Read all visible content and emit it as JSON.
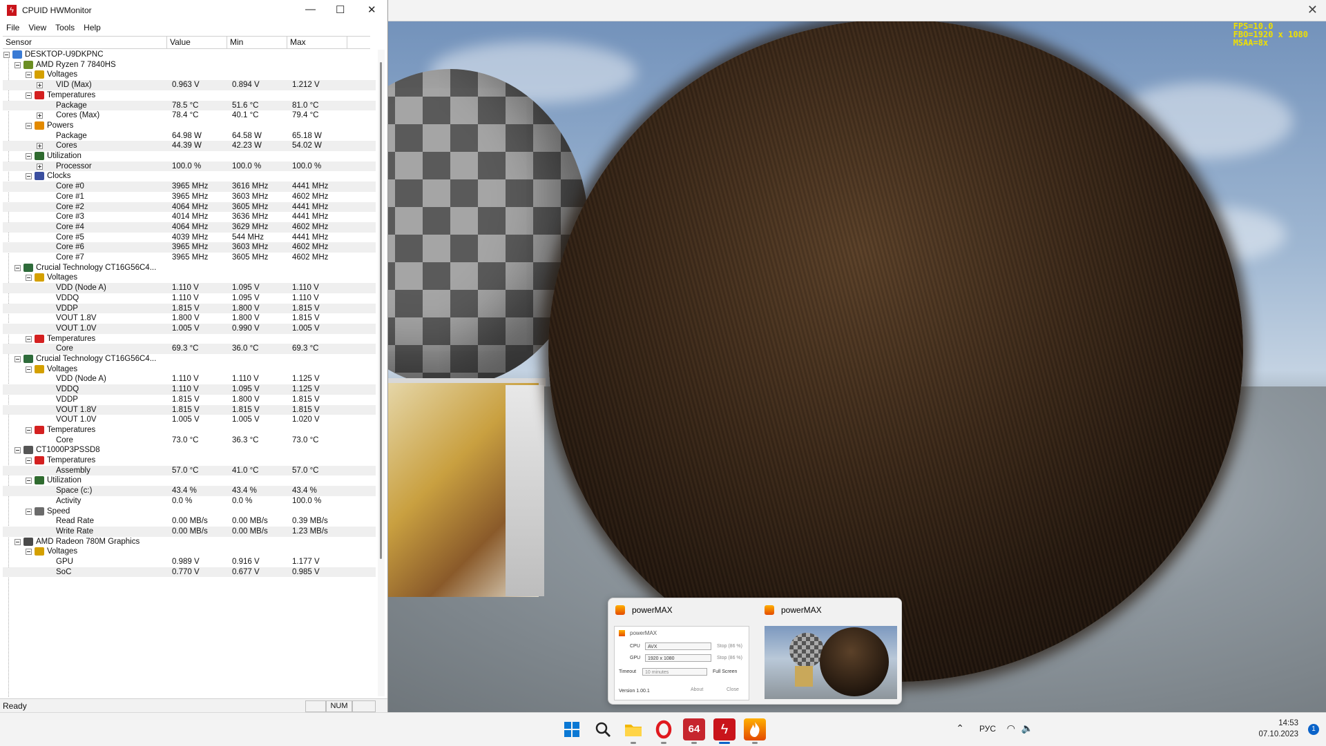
{
  "hwmonitor": {
    "title": "CPUID HWMonitor",
    "menu": [
      "File",
      "View",
      "Tools",
      "Help"
    ],
    "columns": [
      "Sensor",
      "Value",
      "Min",
      "Max"
    ],
    "status": "Ready",
    "num_indicator": "NUM",
    "rows": [
      {
        "depth": 0,
        "label": "DESKTOP-U9DKPNC",
        "icon": "computer-icon",
        "expander": "minus"
      },
      {
        "depth": 1,
        "label": "AMD Ryzen 7 7840HS",
        "icon": "cpu-icon",
        "expander": "minus"
      },
      {
        "depth": 2,
        "label": "Voltages",
        "icon": "voltage-icon",
        "expander": "minus"
      },
      {
        "depth": 3,
        "label": "VID (Max)",
        "expander": "plus",
        "value": "0.963 V",
        "min": "0.894 V",
        "max": "1.212 V"
      },
      {
        "depth": 2,
        "label": "Temperatures",
        "icon": "thermometer-icon",
        "expander": "minus"
      },
      {
        "depth": 3,
        "label": "Package",
        "value": "78.5 °C",
        "min": "51.6 °C",
        "max": "81.0 °C"
      },
      {
        "depth": 3,
        "label": "Cores (Max)",
        "expander": "plus",
        "value": "78.4 °C",
        "min": "40.1 °C",
        "max": "79.4 °C"
      },
      {
        "depth": 2,
        "label": "Powers",
        "icon": "power-icon",
        "expander": "minus"
      },
      {
        "depth": 3,
        "label": "Package",
        "value": "64.98 W",
        "min": "64.58 W",
        "max": "65.18 W"
      },
      {
        "depth": 3,
        "label": "Cores",
        "expander": "plus",
        "value": "44.39 W",
        "min": "42.23 W",
        "max": "54.02 W"
      },
      {
        "depth": 2,
        "label": "Utilization",
        "icon": "utilization-icon",
        "expander": "minus"
      },
      {
        "depth": 3,
        "label": "Processor",
        "expander": "plus",
        "value": "100.0 %",
        "min": "100.0 %",
        "max": "100.0 %"
      },
      {
        "depth": 2,
        "label": "Clocks",
        "icon": "clock-bars-icon",
        "expander": "minus"
      },
      {
        "depth": 3,
        "label": "Core #0",
        "value": "3965 MHz",
        "min": "3616 MHz",
        "max": "4441 MHz"
      },
      {
        "depth": 3,
        "label": "Core #1",
        "value": "3965 MHz",
        "min": "3603 MHz",
        "max": "4602 MHz"
      },
      {
        "depth": 3,
        "label": "Core #2",
        "value": "4064 MHz",
        "min": "3605 MHz",
        "max": "4441 MHz"
      },
      {
        "depth": 3,
        "label": "Core #3",
        "value": "4014 MHz",
        "min": "3636 MHz",
        "max": "4441 MHz"
      },
      {
        "depth": 3,
        "label": "Core #4",
        "value": "4064 MHz",
        "min": "3629 MHz",
        "max": "4602 MHz"
      },
      {
        "depth": 3,
        "label": "Core #5",
        "value": "4039 MHz",
        "min": "544 MHz",
        "max": "4441 MHz"
      },
      {
        "depth": 3,
        "label": "Core #6",
        "value": "3965 MHz",
        "min": "3603 MHz",
        "max": "4602 MHz"
      },
      {
        "depth": 3,
        "label": "Core #7",
        "value": "3965 MHz",
        "min": "3605 MHz",
        "max": "4602 MHz"
      },
      {
        "depth": 1,
        "label": "Crucial Technology CT16G56C4...",
        "icon": "ram-icon",
        "expander": "minus"
      },
      {
        "depth": 2,
        "label": "Voltages",
        "icon": "voltage-icon",
        "expander": "minus"
      },
      {
        "depth": 3,
        "label": "VDD (Node A)",
        "value": "1.110 V",
        "min": "1.095 V",
        "max": "1.110 V"
      },
      {
        "depth": 3,
        "label": "VDDQ",
        "value": "1.110 V",
        "min": "1.095 V",
        "max": "1.110 V"
      },
      {
        "depth": 3,
        "label": "VDDP",
        "value": "1.815 V",
        "min": "1.800 V",
        "max": "1.815 V"
      },
      {
        "depth": 3,
        "label": "VOUT 1.8V",
        "value": "1.800 V",
        "min": "1.800 V",
        "max": "1.815 V"
      },
      {
        "depth": 3,
        "label": "VOUT 1.0V",
        "value": "1.005 V",
        "min": "0.990 V",
        "max": "1.005 V"
      },
      {
        "depth": 2,
        "label": "Temperatures",
        "icon": "thermometer-icon",
        "expander": "minus"
      },
      {
        "depth": 3,
        "label": "Core",
        "value": "69.3 °C",
        "min": "36.0 °C",
        "max": "69.3 °C"
      },
      {
        "depth": 1,
        "label": "Crucial Technology CT16G56C4...",
        "icon": "ram-icon",
        "expander": "minus"
      },
      {
        "depth": 2,
        "label": "Voltages",
        "icon": "voltage-icon",
        "expander": "minus"
      },
      {
        "depth": 3,
        "label": "VDD (Node A)",
        "value": "1.110 V",
        "min": "1.110 V",
        "max": "1.125 V"
      },
      {
        "depth": 3,
        "label": "VDDQ",
        "value": "1.110 V",
        "min": "1.095 V",
        "max": "1.125 V"
      },
      {
        "depth": 3,
        "label": "VDDP",
        "value": "1.815 V",
        "min": "1.800 V",
        "max": "1.815 V"
      },
      {
        "depth": 3,
        "label": "VOUT 1.8V",
        "value": "1.815 V",
        "min": "1.815 V",
        "max": "1.815 V"
      },
      {
        "depth": 3,
        "label": "VOUT 1.0V",
        "value": "1.005 V",
        "min": "1.005 V",
        "max": "1.020 V"
      },
      {
        "depth": 2,
        "label": "Temperatures",
        "icon": "thermometer-icon",
        "expander": "minus"
      },
      {
        "depth": 3,
        "label": "Core",
        "value": "73.0 °C",
        "min": "36.3 °C",
        "max": "73.0 °C"
      },
      {
        "depth": 1,
        "label": "CT1000P3PSSD8",
        "icon": "ssd-icon",
        "expander": "minus"
      },
      {
        "depth": 2,
        "label": "Temperatures",
        "icon": "thermometer-icon",
        "expander": "minus"
      },
      {
        "depth": 3,
        "label": "Assembly",
        "value": "57.0 °C",
        "min": "41.0 °C",
        "max": "57.0 °C"
      },
      {
        "depth": 2,
        "label": "Utilization",
        "icon": "utilization-icon",
        "expander": "minus"
      },
      {
        "depth": 3,
        "label": "Space (c:)",
        "value": "43.4 %",
        "min": "43.4 %",
        "max": "43.4 %"
      },
      {
        "depth": 3,
        "label": "Activity",
        "value": "0.0 %",
        "min": "0.0 %",
        "max": "100.0 %"
      },
      {
        "depth": 2,
        "label": "Speed",
        "icon": "speed-icon",
        "expander": "minus"
      },
      {
        "depth": 3,
        "label": "Read Rate",
        "value": "0.00 MB/s",
        "min": "0.00 MB/s",
        "max": "0.39 MB/s"
      },
      {
        "depth": 3,
        "label": "Write Rate",
        "value": "0.00 MB/s",
        "min": "0.00 MB/s",
        "max": "1.23 MB/s"
      },
      {
        "depth": 1,
        "label": "AMD Radeon 780M Graphics",
        "icon": "gpu-icon",
        "expander": "minus"
      },
      {
        "depth": 2,
        "label": "Voltages",
        "icon": "voltage-icon",
        "expander": "minus"
      },
      {
        "depth": 3,
        "label": "GPU",
        "value": "0.989 V",
        "min": "0.916 V",
        "max": "1.177 V"
      },
      {
        "depth": 3,
        "label": "SoC",
        "value": "0.770 V",
        "min": "0.677 V",
        "max": "0.985 V"
      }
    ]
  },
  "scene": {
    "overlay": [
      "FPS=10.0",
      "FBO=1920 x 1080",
      "MSAA=8x"
    ]
  },
  "popup": {
    "items": [
      {
        "title": "powerMAX"
      },
      {
        "title": "powerMAX"
      }
    ],
    "mini": {
      "title": "powerMAX",
      "cpu_label": "CPU",
      "cpu_value": "AVX",
      "cpu_stop": "Stop (86 %)",
      "gpu_label": "GPU",
      "gpu_value": "1920 x 1080",
      "gpu_stop": "Stop (86 %)",
      "timeout_label": "Timeout",
      "timeout_value": "10 minutes",
      "fullscreen_label": "Full Screen",
      "version": "Version 1.00.1",
      "about": "About",
      "close": "Close"
    }
  },
  "taskbar": {
    "lang": "РУС",
    "time": "14:53",
    "date": "07.10.2023",
    "notification_count": "1",
    "app_64_label": "64"
  },
  "colors": {
    "hwmonitor_red": "#c9141b",
    "overlay_yellow": "#f0e000",
    "row_shade": "#efefef"
  }
}
